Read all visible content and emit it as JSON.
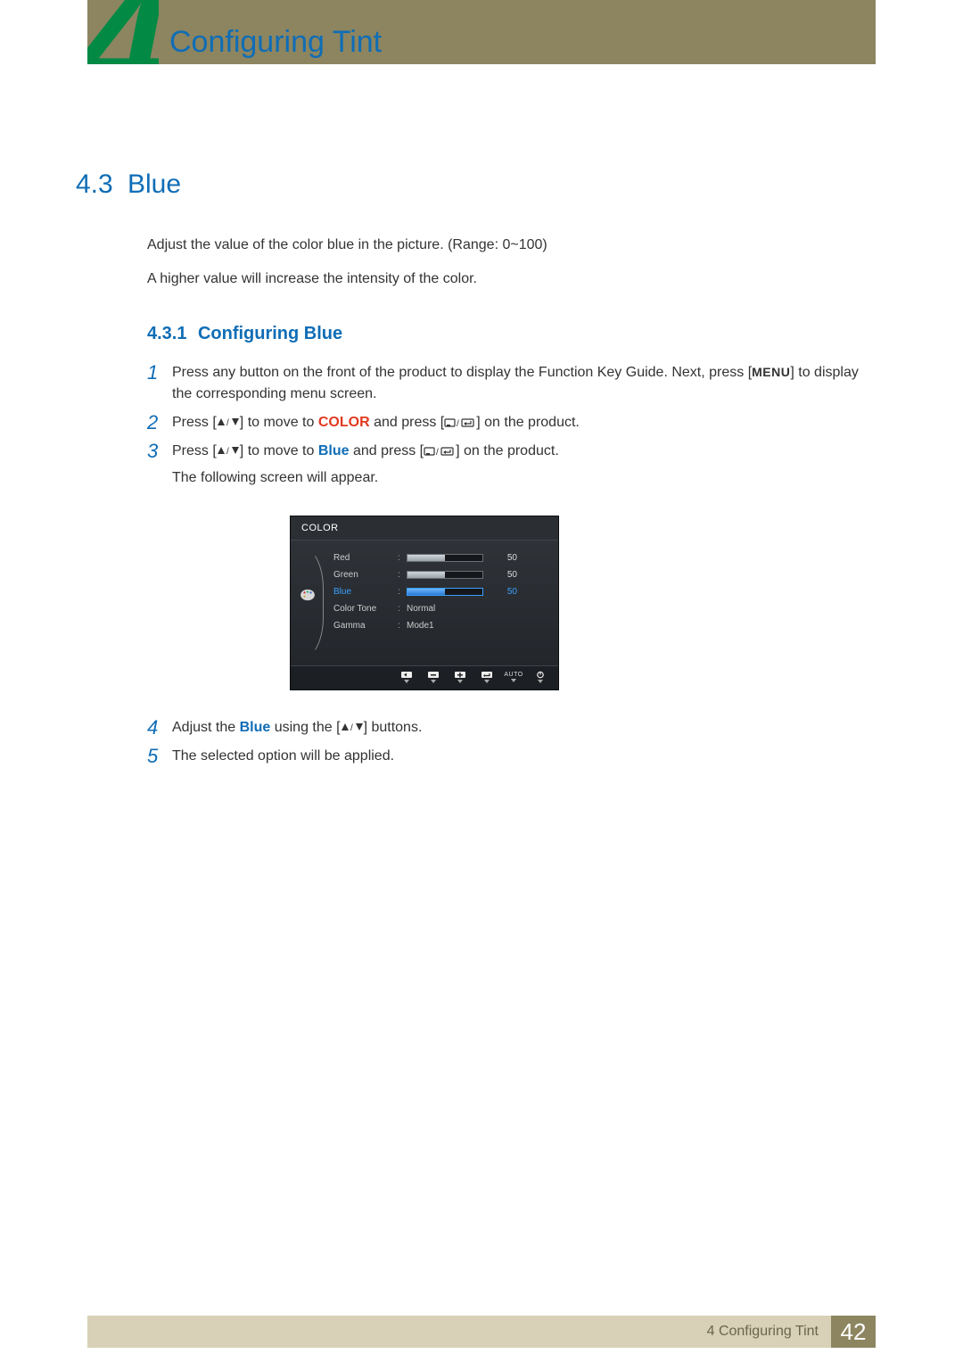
{
  "chapter": {
    "number": "4",
    "title": "Configuring Tint"
  },
  "section": {
    "number": "4.3",
    "title": "Blue"
  },
  "intro": {
    "p1": "Adjust the value of the color blue in the picture. (Range: 0~100)",
    "p2": "A higher value will increase the intensity of the color."
  },
  "subsection": {
    "number": "4.3.1",
    "title": "Configuring Blue"
  },
  "steps": {
    "s1": {
      "num": "1",
      "pre": "Press any button on the front of the product to display the Function Key Guide. Next, press [",
      "menu": "MENU",
      "post": "] to display the corresponding menu screen."
    },
    "s2": {
      "num": "2",
      "pre": "Press [",
      "mid1": "] to move to ",
      "kw": "COLOR",
      "mid2": " and press [",
      "post": "] on the product."
    },
    "s3": {
      "num": "3",
      "pre": "Press [",
      "mid1": "] to move to ",
      "kw": "Blue",
      "mid2": " and press [",
      "post": "] on the product.",
      "after": "The following screen will appear."
    },
    "s4": {
      "num": "4",
      "pre": "Adjust the ",
      "kw": "Blue",
      "mid": " using the [",
      "post": "] buttons."
    },
    "s5": {
      "num": "5",
      "text": "The selected option will be applied."
    }
  },
  "osd": {
    "title": "COLOR",
    "rows": {
      "red": {
        "label": "Red",
        "value": "50"
      },
      "green": {
        "label": "Green",
        "value": "50"
      },
      "blue": {
        "label": "Blue",
        "value": "50"
      },
      "tone": {
        "label": "Color Tone",
        "value": "Normal"
      },
      "gamma": {
        "label": "Gamma",
        "value": "Mode1"
      }
    },
    "footer_auto": "AUTO"
  },
  "footer": {
    "chapter_ref": "4 Configuring Tint",
    "page": "42"
  }
}
